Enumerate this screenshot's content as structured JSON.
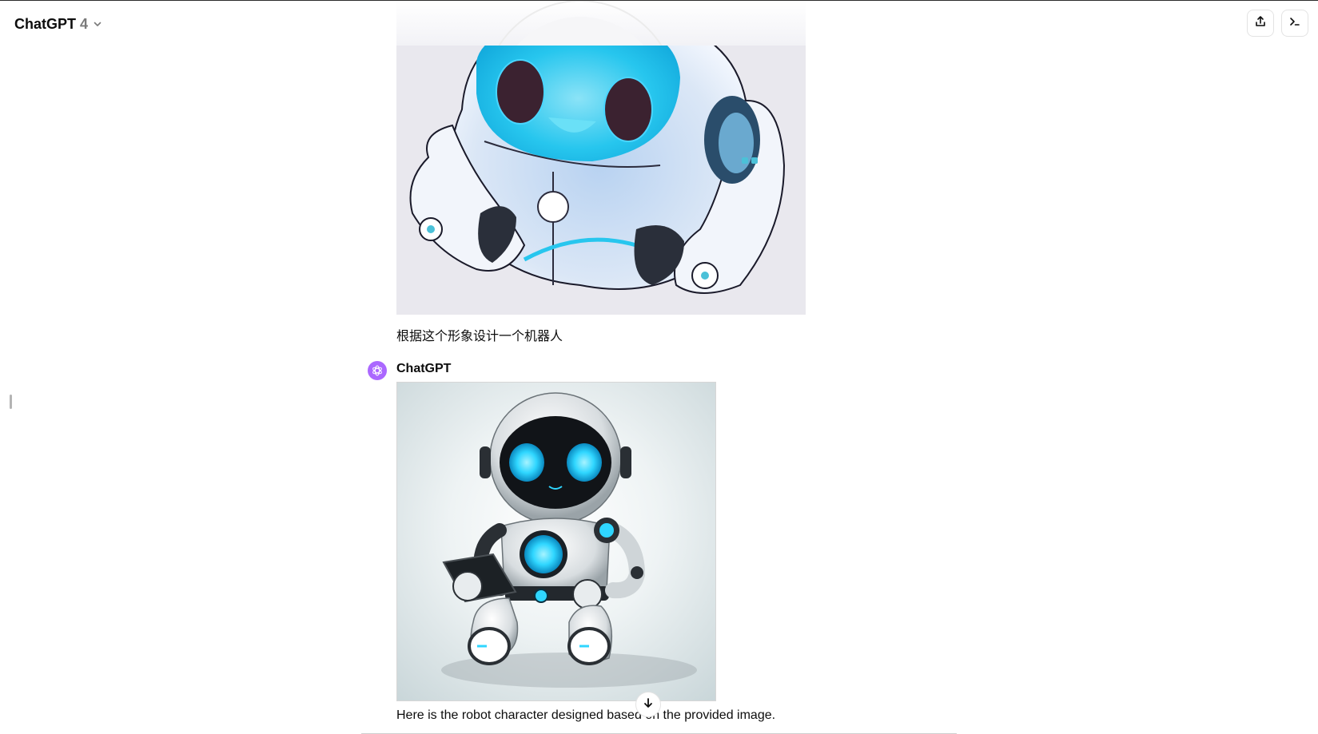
{
  "header": {
    "model_name": "ChatGPT",
    "model_version": "4",
    "icons": {
      "model_dropdown": "chevron-down-icon",
      "share": "share-icon",
      "code": "terminal-icon"
    }
  },
  "conversation": {
    "user_message": {
      "image_description_icon": "robot-sketch-image",
      "text": "根据这个形象设计一个机器人"
    },
    "assistant_message": {
      "author": "ChatGPT",
      "image_description_icon": "generated-robot-image",
      "text": "Here is the robot character designed based on the provided image."
    }
  },
  "controls": {
    "scroll_down_icon": "arrow-down-icon"
  },
  "colors": {
    "accent_avatar": "#ab68ff",
    "robot_glow": "#2fd6ff"
  }
}
